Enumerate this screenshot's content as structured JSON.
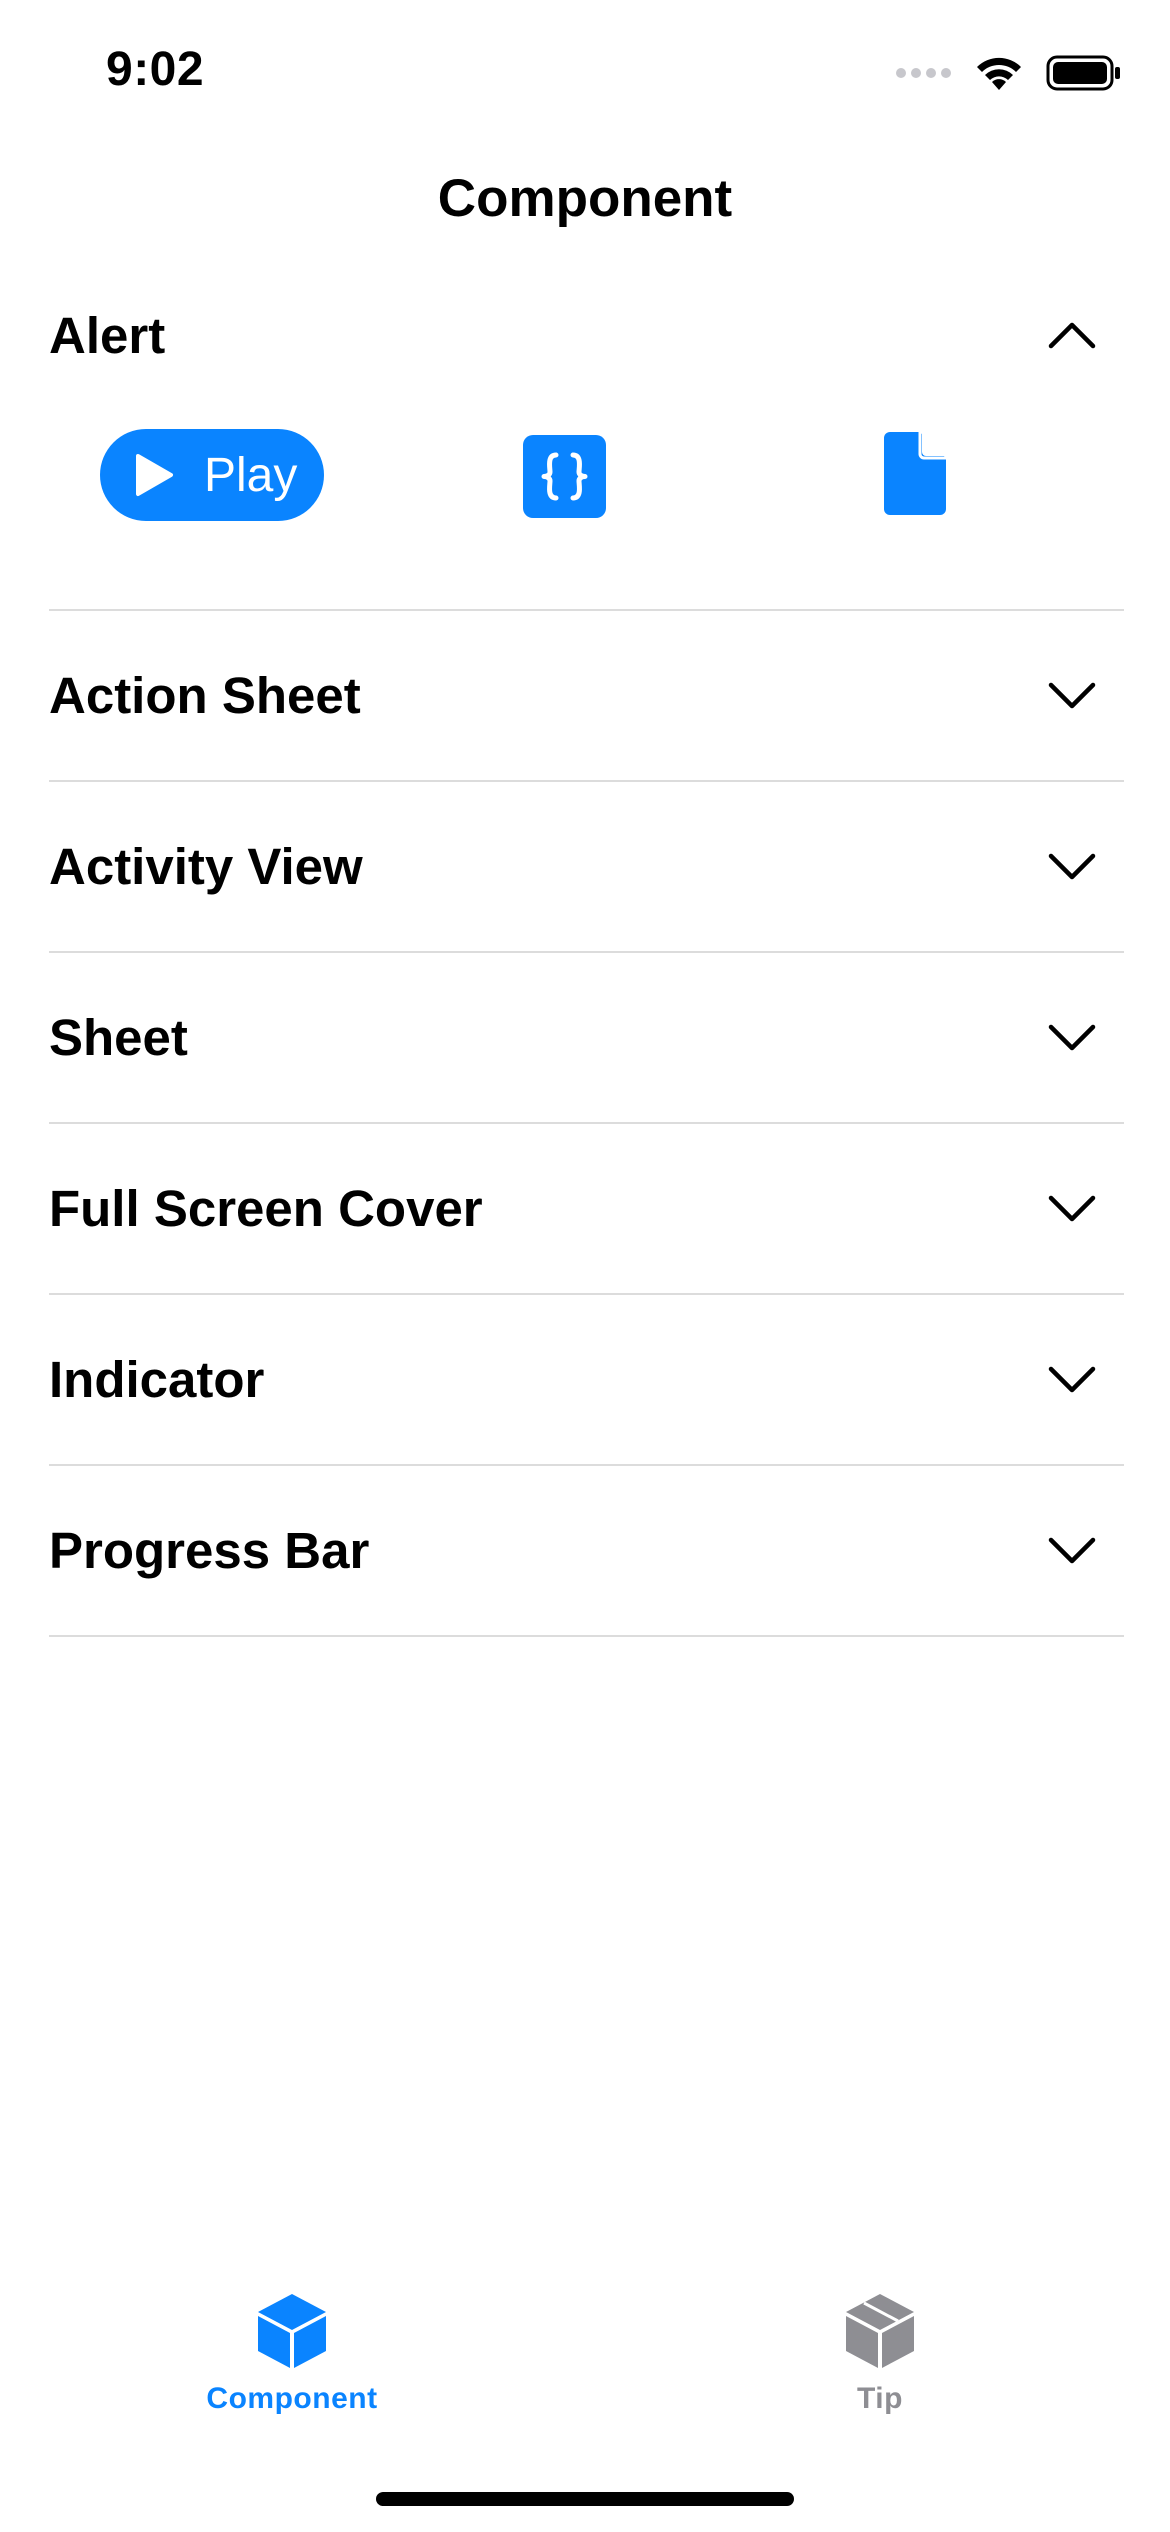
{
  "status_bar": {
    "time": "9:02",
    "icons": [
      "signal-icon",
      "wifi-icon",
      "battery-icon"
    ]
  },
  "nav": {
    "title": "Component"
  },
  "list": {
    "items": [
      {
        "label": "Alert",
        "expanded": true,
        "chevron": "chevron-up-icon",
        "actions": {
          "play_label": "Play",
          "code_icon": "code-braces-icon",
          "document_icon": "document-icon"
        }
      },
      {
        "label": "Action Sheet",
        "expanded": false,
        "chevron": "chevron-down-icon"
      },
      {
        "label": "Activity View",
        "expanded": false,
        "chevron": "chevron-down-icon"
      },
      {
        "label": "Sheet",
        "expanded": false,
        "chevron": "chevron-down-icon"
      },
      {
        "label": "Full Screen Cover",
        "expanded": false,
        "chevron": "chevron-down-icon"
      },
      {
        "label": "Indicator",
        "expanded": false,
        "chevron": "chevron-down-icon"
      },
      {
        "label": "Progress Bar",
        "expanded": false,
        "chevron": "chevron-down-icon"
      }
    ]
  },
  "tab_bar": {
    "tabs": [
      {
        "label": "Component",
        "icon": "cube-icon",
        "selected": true
      },
      {
        "label": "Tip",
        "icon": "cube-icon",
        "selected": false
      }
    ]
  },
  "colors": {
    "accent": "#0a84ff",
    "inactive": "#8e8e93",
    "separator": "#dcdcdc",
    "text": "#000000",
    "background": "#ffffff"
  }
}
